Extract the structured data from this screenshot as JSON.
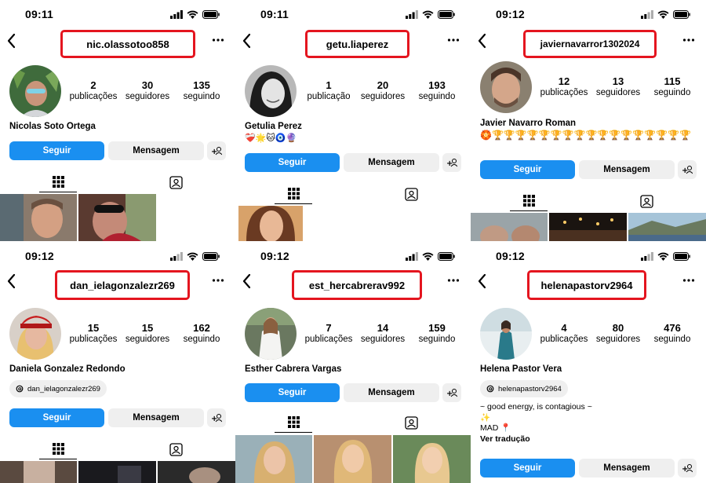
{
  "status_time_top": "09:11",
  "status_time_top3": "09:12",
  "status_time_bottom": "09:12",
  "labels": {
    "publicacoes": "publicações",
    "publicacao": "publicação",
    "seguidores": "seguidores",
    "seguindo": "seguindo",
    "follow": "Seguir",
    "message": "Mensagem",
    "translate": "Ver tradução"
  },
  "profiles": [
    {
      "time": "09:11",
      "handle": "nic.olassotoo858",
      "posts": "2",
      "posts_label": "publicações",
      "followers": "30",
      "following": "135",
      "name": "Nicolas Soto Ortega"
    },
    {
      "time": "09:11",
      "handle": "getu.liaperez",
      "posts": "1",
      "posts_label": "publicação",
      "followers": "20",
      "following": "193",
      "name": "Getulia Perez",
      "emoji": "❤️‍🩹🌟🐱🧿🔮"
    },
    {
      "time": "09:12",
      "handle": "javiernavarror1302024",
      "posts": "12",
      "posts_label": "publicações",
      "followers": "13",
      "following": "115",
      "name": "Javier Navarro Roman",
      "emoji": "🏵️🏆🏆🏆🏆🏆🏆🏆🏆🏆🏆🏆🏆🏆🏆🏆🏆🏆"
    },
    {
      "time": "09:12",
      "handle": "dan_ielagonzalezr269",
      "posts": "15",
      "posts_label": "publicações",
      "followers": "15",
      "following": "162",
      "name": "Daniela Gonzalez Redondo",
      "threads": "dan_ielagonzalezr269"
    },
    {
      "time": "09:12",
      "handle": "est_hercabrerav992",
      "posts": "7",
      "posts_label": "publicações",
      "followers": "14",
      "following": "159",
      "name": "Esther Cabrera Vargas"
    },
    {
      "time": "09:12",
      "handle": "helenapastorv2964",
      "posts": "4",
      "posts_label": "publicações",
      "followers": "80",
      "following": "476",
      "name": "Helena Pastor Vera",
      "threads": "helenapastorv2964",
      "bio1": "~ good energy, is contagious ~",
      "bio2": "✨",
      "bio3": "MAD 📍"
    }
  ],
  "colors": {
    "accent": "#1a8ff0",
    "highlight_box": "#e4151f",
    "button_gray": "#efefef"
  },
  "icons": [
    "back-icon",
    "more-icon",
    "signal-icon",
    "wifi-icon",
    "battery-icon",
    "grid-icon",
    "tagged-icon",
    "add-person-icon",
    "threads-icon"
  ]
}
